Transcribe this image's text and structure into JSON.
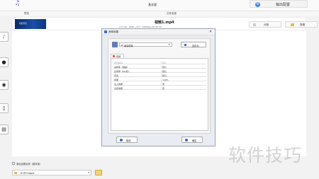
{
  "titlebar": {
    "app_icon": "music-note-icon",
    "title": "基本量",
    "output_button_label": "输出配置",
    "output_button_icon": "settings-circle-icon"
  },
  "subbar": {
    "left_label": "预览",
    "right_label": "文件信息"
  },
  "file": {
    "thumbnail_text": "视频预览",
    "name": "视频1.mp4",
    "info": "177 KB  ,  4000  |  2ch , 2000bps  00:00:30",
    "split_button": "分割",
    "edit_button": "剪辑"
  },
  "sidebar": {
    "icons": [
      "audio-icon",
      "video-icon",
      "disc-icon",
      "document-icon",
      "file-icon"
    ]
  },
  "dialog": {
    "title": "音频设置",
    "close_symbol": "✕",
    "profile_value": "最高质量",
    "save_as_label": "另存为",
    "tab_label": "音频",
    "settings": [
      {
        "key": "音频编码",
        "value": "默认",
        "dim": true
      },
      {
        "key": "采样率（赫兹）",
        "value": "默认",
        "dim": false
      },
      {
        "key": "比特率（Kb/秒）",
        "value": "默认",
        "dim": false
      },
      {
        "key": "声道",
        "value": "默认",
        "dim": false
      },
      {
        "key": "音量",
        "value": "100%",
        "dim": false
      },
      {
        "key": "淡入效果",
        "value": "否",
        "dim": false
      },
      {
        "key": "淡出效果",
        "value": "否",
        "dim": false
      }
    ],
    "cancel_label": "取消",
    "ok_label": "确定"
  },
  "bottom": {
    "checkbox_label": "添加设置名称（基本量）",
    "output_dir": "D:\\FFOutput",
    "folder_icon": "folder-icon"
  },
  "watermark": "软件技巧",
  "colors": {
    "accent_blue": "#3a86e8",
    "thumb_blue": "#1b4ea8",
    "profile_orange": "#e05a28",
    "folder_yellow": "#f2b84b"
  }
}
